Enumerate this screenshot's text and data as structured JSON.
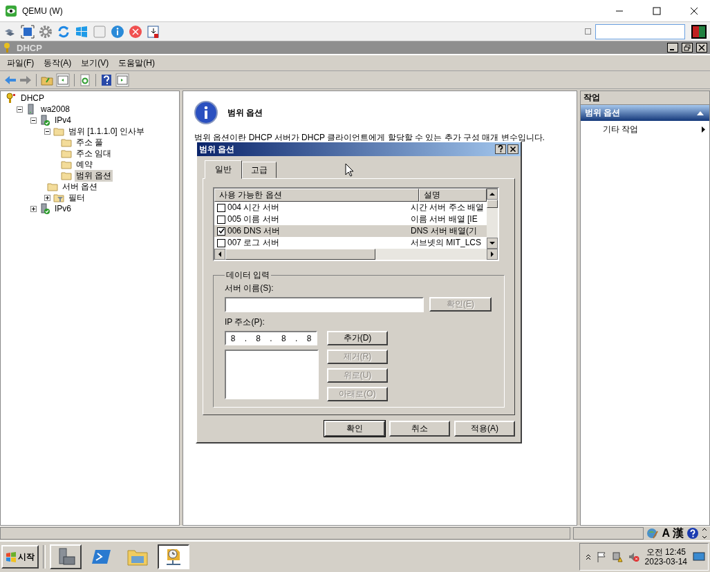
{
  "window": {
    "title": "QEMU (W)"
  },
  "mmc": {
    "title": "DHCP",
    "menu": [
      "파일(F)",
      "동작(A)",
      "보기(V)",
      "도움말(H)"
    ]
  },
  "tree": [
    {
      "label": "DHCP",
      "kind": "dhcp",
      "selected": false,
      "children": [
        {
          "label": "wa2008",
          "kind": "server",
          "expanded": true,
          "selected": false,
          "children": [
            {
              "label": "IPv4",
              "kind": "ip",
              "expanded": true,
              "selected": false,
              "children": [
                {
                  "label": "범위 [1.1.1.0] 인사부",
                  "kind": "folder",
                  "expanded": true,
                  "selected": false,
                  "children": [
                    {
                      "label": "주소 풀",
                      "kind": "folder",
                      "selected": false
                    },
                    {
                      "label": "주소 임대",
                      "kind": "folder",
                      "selected": false
                    },
                    {
                      "label": "예약",
                      "kind": "folder",
                      "selected": false
                    },
                    {
                      "label": "범위 옵션",
                      "kind": "folder",
                      "selected": true
                    }
                  ]
                },
                {
                  "label": "서버 옵션",
                  "kind": "folder",
                  "selected": false
                },
                {
                  "label": "필터",
                  "kind": "filter",
                  "expanded": false,
                  "selected": false
                }
              ]
            },
            {
              "label": "IPv6",
              "kind": "ip",
              "expanded": false,
              "selected": false
            }
          ]
        }
      ]
    }
  ],
  "content": {
    "heading": "범위 옵션",
    "lines": [
      "범위 옵션이란 DHCP 서버가 DHCP 클라이언트에게 할당할 수 있는 추가 구성 매개 변수입니다."
    ]
  },
  "dialog": {
    "title": "범위 옵션",
    "tabs": [
      {
        "label": "일반",
        "selected": true
      },
      {
        "label": "고급",
        "selected": false
      }
    ],
    "columns": [
      "사용 가능한 옵션",
      "설명"
    ],
    "options": [
      {
        "name": "004 시간 서버",
        "description": "시간 서버 주소 배열",
        "checked": false,
        "selected": false
      },
      {
        "name": "005 이름 서버",
        "description": "이름 서버 배열 [IE",
        "checked": false,
        "selected": false
      },
      {
        "name": "006 DNS 서버",
        "description": "DNS 서버 배열(기",
        "checked": true,
        "selected": true
      },
      {
        "name": "007 로그 서버",
        "description": "서브넷의 MIT_LCS",
        "checked": false,
        "selected": false
      }
    ],
    "group": "데이터 입력",
    "server_label": "서버 이름(S):",
    "resolve_button": {
      "label": "확인(E)",
      "disabled": true
    },
    "ip_label": "IP 주소(P):",
    "ip_parts": [
      "8",
      ".",
      "8",
      ".",
      "8",
      ".",
      "8"
    ],
    "side_buttons": [
      {
        "label": "추가(D)",
        "disabled": false
      },
      {
        "label": "제거(R)",
        "disabled": true
      },
      {
        "label": "위로(U)",
        "disabled": true
      },
      {
        "label": "아래로(O)",
        "disabled": true
      }
    ],
    "buttons": [
      {
        "label": "확인",
        "default": true
      },
      {
        "label": "취소",
        "default": false
      },
      {
        "label": "적용(A)",
        "default": false
      }
    ]
  },
  "actions": {
    "header": "작업",
    "section": "범위 옵션",
    "items": [
      "기타 작업"
    ]
  },
  "status_bar": {
    "ime": [
      "A",
      "漢"
    ]
  },
  "taskbar": {
    "start": "시작",
    "time": "오전 12:45",
    "date": "2023-03-14"
  }
}
